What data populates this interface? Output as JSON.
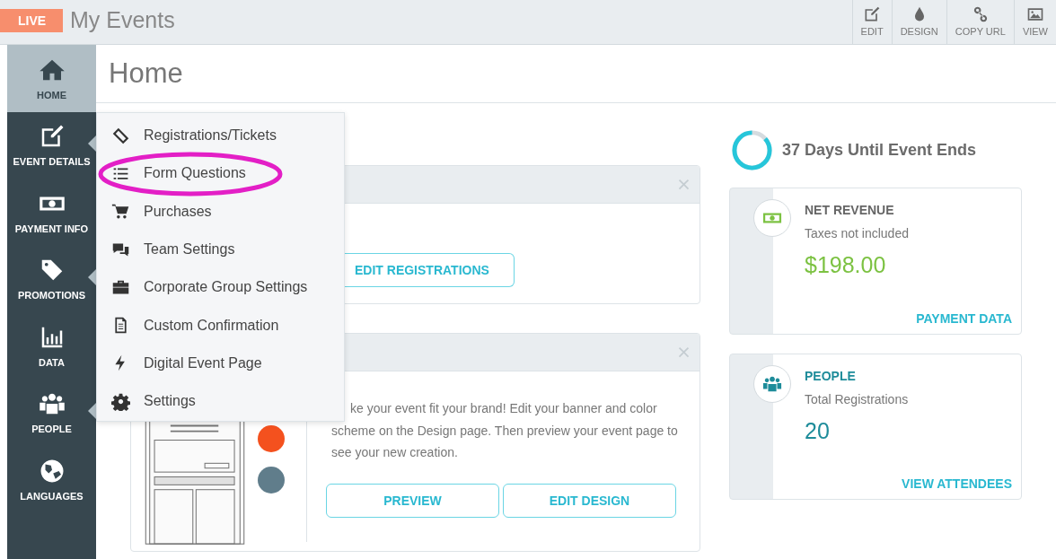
{
  "top_bar": {
    "badge": "LIVE",
    "title": "My Events",
    "actions": [
      {
        "label": "EDIT"
      },
      {
        "label": "DESIGN"
      },
      {
        "label": "COPY URL"
      },
      {
        "label": "VIEW"
      }
    ]
  },
  "sidebar": {
    "items": [
      {
        "label": "HOME",
        "selected": true,
        "has_submenu": false
      },
      {
        "label": "EVENT DETAILS",
        "selected": false,
        "has_submenu": true
      },
      {
        "label": "PAYMENT INFO",
        "selected": false,
        "has_submenu": false
      },
      {
        "label": "PROMOTIONS",
        "selected": false,
        "has_submenu": true
      },
      {
        "label": "DATA",
        "selected": false,
        "has_submenu": false
      },
      {
        "label": "PEOPLE",
        "selected": false,
        "has_submenu": true
      },
      {
        "label": "LANGUAGES",
        "selected": false,
        "has_submenu": false
      }
    ]
  },
  "page_title": "Home",
  "dropdown_menu": {
    "items": [
      {
        "label": "Registrations/Tickets",
        "circled": false
      },
      {
        "label": "Form Questions",
        "circled": true
      },
      {
        "label": "Purchases",
        "circled": false
      },
      {
        "label": "Team Settings",
        "circled": false
      },
      {
        "label": "Corporate Group Settings",
        "circled": false
      },
      {
        "label": "Custom Confirmation",
        "circled": false
      },
      {
        "label": "Digital Event Page",
        "circled": false
      },
      {
        "label": "Settings",
        "circled": false
      }
    ]
  },
  "registrations_card": {
    "buttons": [
      "EDIT REGISTRATIONS"
    ]
  },
  "design_card": {
    "text": "ke your event fit your brand! Edit your banner and color scheme on the Design page. Then preview your event page to see your new creation.",
    "swatches": [
      {
        "color": "#f4511e"
      },
      {
        "color": "#607d8b"
      }
    ],
    "buttons": [
      "PREVIEW",
      "EDIT DESIGN"
    ]
  },
  "countdown": {
    "text": "37 Days Until Event Ends",
    "level": 0.86
  },
  "stats": [
    {
      "kind": "money",
      "title": "NET REVENUE",
      "subtitle": "Taxes not included",
      "value": "$198.00",
      "color": "#7cc242",
      "link": "PAYMENT DATA"
    },
    {
      "kind": "people",
      "title": "PEOPLE",
      "subtitle": "Total Registrations",
      "value": "20",
      "color": "#1e8c9a",
      "link": "VIEW ATTENDEES"
    }
  ]
}
